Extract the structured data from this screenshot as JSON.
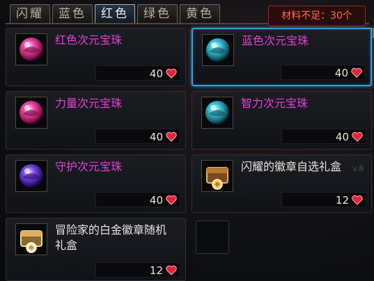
{
  "tabs": [
    {
      "label": "闪耀",
      "active": false
    },
    {
      "label": "蓝色",
      "active": false
    },
    {
      "label": "红色",
      "active": true
    },
    {
      "label": "绿色",
      "active": false
    },
    {
      "label": "黄色",
      "active": false
    }
  ],
  "status": {
    "shortage": "材料不足：30个"
  },
  "close_label": "×",
  "side_text": "v.8",
  "items": [
    {
      "name": "红色次元宝珠",
      "cost": "40",
      "icon": "red-orb-icon",
      "name_color": "magenta"
    },
    {
      "name": "蓝色次元宝珠",
      "cost": "40",
      "icon": "blue-orb-icon",
      "name_color": "magenta",
      "selected": true
    },
    {
      "name": "力量次元宝珠",
      "cost": "40",
      "icon": "red-orb-icon",
      "name_color": "magenta"
    },
    {
      "name": "智力次元宝珠",
      "cost": "40",
      "icon": "blue-orb-icon",
      "name_color": "magenta"
    },
    {
      "name": "守护次元宝珠",
      "cost": "40",
      "icon": "purple-orb-icon",
      "name_color": "magenta"
    },
    {
      "name": "闪耀的徽章自选礼盒",
      "cost": "12",
      "icon": "badge-box-icon",
      "name_color": "white"
    },
    {
      "name": "冒险家的白金徽章随机\n礼盒",
      "cost": "12",
      "icon": "platinum-box-icon",
      "name_color": "white"
    }
  ]
}
